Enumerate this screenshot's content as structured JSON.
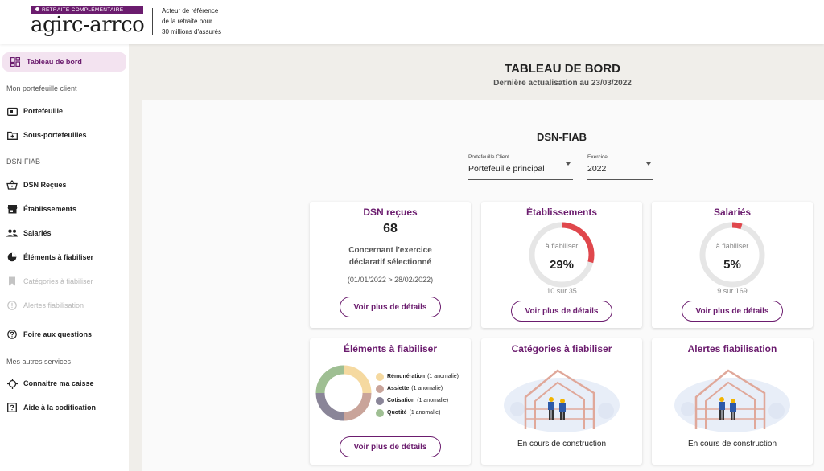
{
  "header": {
    "logo_band": "RETRAITE COMPLÉMENTAIRE",
    "logo_word": "agirc-arrco",
    "tagline_1": "Acteur de référence",
    "tagline_2": "de la retraite pour",
    "tagline_3": "30 millions d'assurés"
  },
  "sidebar": {
    "dashboard": "Tableau de bord",
    "section_portfolio": "Mon portefeuille client",
    "portfolio": "Portefeuille",
    "sub_portfolios": "Sous-portefeuilles",
    "section_dsn": "DSN-FIAB",
    "dsn_received": "DSN Reçues",
    "establishments": "Établissements",
    "employees": "Salariés",
    "elements": "Éléments à fiabiliser",
    "categories": "Catégories à fiabiliser",
    "alerts": "Alertes fiabilisation",
    "faq": "Foire aux questions",
    "section_services": "Mes autres services",
    "know_fund": "Connaitre ma caisse",
    "coding_help": "Aide à la codification"
  },
  "main": {
    "title": "TABLEAU DE BORD",
    "subtitle": "Dernière actualisation au 23/03/2022",
    "section_title": "DSN-FIAB",
    "filter_portfolio_label": "Portefeuille Client",
    "filter_portfolio_value": "Portefeuille principal",
    "filter_year_label": "Exercice",
    "filter_year_value": "2022"
  },
  "cards": {
    "dsn": {
      "title": "DSN reçues",
      "count": "68",
      "text_1": "Concernant l'exercice",
      "text_2": "déclaratif sélectionné",
      "period": "(01/01/2022 > 28/02/2022)",
      "button": "Voir plus de détails"
    },
    "establishments": {
      "title": "Établissements",
      "gauge_label": "à fiabiliser",
      "percent": "29%",
      "fraction": 0.29,
      "ratio": "10 sur 35",
      "button": "Voir plus de détails"
    },
    "employees": {
      "title": "Salariés",
      "gauge_label": "à fiabiliser",
      "percent": "5%",
      "fraction": 0.05,
      "ratio": "9 sur 169",
      "button": "Voir plus de détails"
    },
    "elements": {
      "title": "Éléments à fiabiliser",
      "legend": [
        {
          "name": "Rémunération",
          "note": "(1 anomalie)",
          "color": "#f5d9a0",
          "value": 1
        },
        {
          "name": "Assiette",
          "note": "(1 anomalie)",
          "color": "#c9a49a",
          "value": 1
        },
        {
          "name": "Cotisation",
          "note": "(1 anomalie)",
          "color": "#8a8598",
          "value": 1
        },
        {
          "name": "Quotité",
          "note": "(1 anomalie)",
          "color": "#9fbf93",
          "value": 1
        }
      ],
      "button": "Voir plus de détails"
    },
    "categories": {
      "title": "Catégories à fiabiliser",
      "status": "En cours de construction"
    },
    "alerts": {
      "title": "Alertes fiabilisation",
      "status": "En cours de construction"
    }
  },
  "colors": {
    "brand": "#6b1c6e",
    "gauge_red": "#e0474c",
    "gauge_track": "#e6e6e6"
  }
}
